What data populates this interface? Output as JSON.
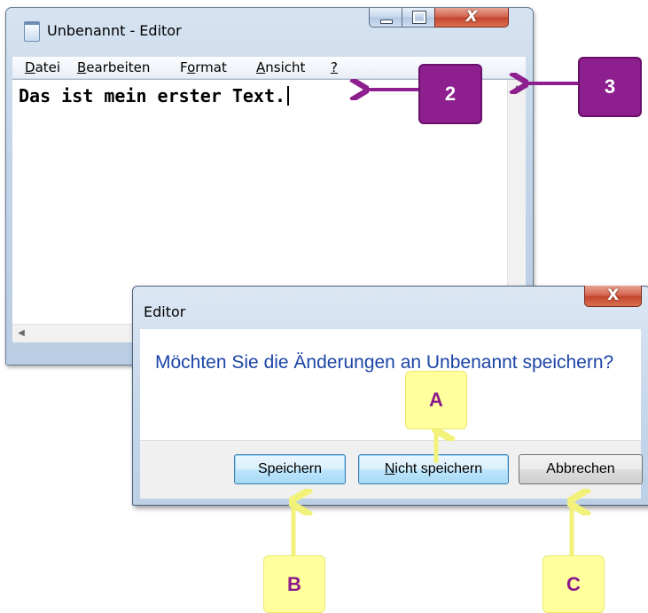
{
  "notepad": {
    "title": "Unbenannt - Editor",
    "menu": {
      "datei": {
        "u": "D",
        "rest": "atei"
      },
      "bearbeiten": {
        "u": "B",
        "rest": "earbeiten"
      },
      "format": {
        "pre": "F",
        "u": "o",
        "rest": "rmat"
      },
      "ansicht": {
        "u": "A",
        "rest": "nsicht"
      },
      "help": {
        "u": "?"
      }
    },
    "text": "Das ist mein erster Text."
  },
  "dialog": {
    "title": "Editor",
    "close_glyph": "X",
    "message": "Möchten Sie die Änderungen an Unbenannt speichern?",
    "buttons": {
      "save": "Speichern",
      "nosave": {
        "u": "N",
        "rest": "icht speichern"
      },
      "cancel": "Abbrechen"
    }
  },
  "window_buttons": {
    "close_glyph": "X"
  },
  "annotations": {
    "label_2": "2",
    "label_3": "3",
    "label_A": "A",
    "label_B": "B",
    "label_C": "C",
    "colors": {
      "purple": "#8e1f8e",
      "yellow": "#ffff9e"
    }
  }
}
